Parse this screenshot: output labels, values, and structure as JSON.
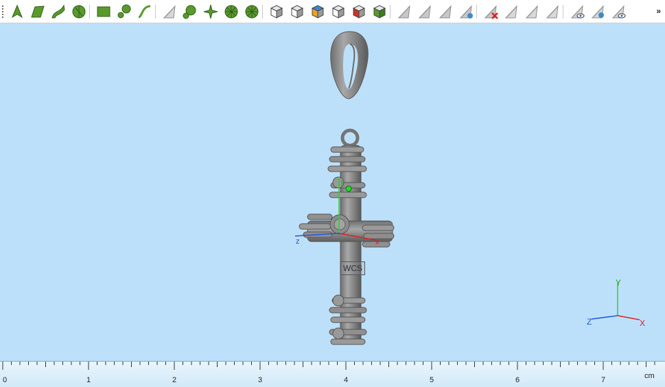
{
  "toolbar": {
    "overflow": "»",
    "groups": [
      [
        "point-icon",
        "plane-icon",
        "curve-icon",
        "circle-icon"
      ],
      [
        "rectangle-icon",
        "node-icon",
        "spline-icon"
      ],
      [
        "triangle-face-icon",
        "pie-icon",
        "star-segments-icon",
        "wheel-icon",
        "fan-icon"
      ],
      [
        "cube-select-icon",
        "cube-icon",
        "cube-color-icon",
        "cube-wire-icon",
        "cube-red-icon",
        "cube-green-icon"
      ],
      [
        "cursor-gray-icon",
        "cursor-arrow-icon",
        "cursor-split-icon",
        "cursor-shade-icon"
      ],
      [
        "cursor-delete-icon",
        "triangle-hatch-icon",
        "triangle-copy-icon",
        "triangle-paper-icon"
      ],
      [
        "triangle-eye-icon",
        "triangle-eye-blue-icon",
        "triangle-eye-hide-icon"
      ]
    ]
  },
  "viewport": {
    "background": "#bde0fa",
    "model_label": "WCS",
    "local_axes": {
      "x": "x",
      "y": "y",
      "z": "z"
    },
    "corner_axes": {
      "x": "X",
      "y": "Y",
      "z": "Z"
    }
  },
  "ruler": {
    "unit": "cm",
    "ticks": [
      "0",
      "1",
      "2",
      "3",
      "4",
      "5",
      "6",
      "7"
    ]
  }
}
